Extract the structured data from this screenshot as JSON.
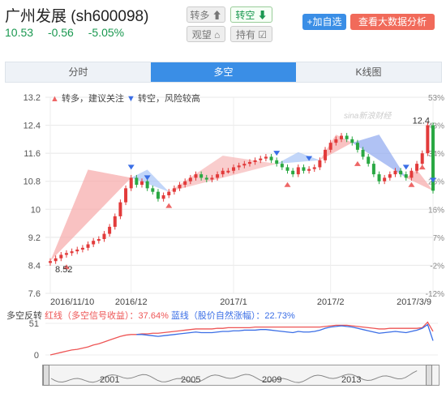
{
  "stock": {
    "name_code": "广州发展 (sh600098)",
    "price": "10.53",
    "change": "-0.56",
    "change_pct": "-5.05%"
  },
  "ops": {
    "to_long": "转多 ⬆",
    "to_short": "转空 ⬇",
    "watch": "观望 ⌂",
    "hold": "持有 ☑"
  },
  "buttons": {
    "add_watch": "+加自选",
    "big_data": "查看大数据分析"
  },
  "tabs": [
    "分时",
    "多空",
    "K线图"
  ],
  "legend": {
    "up_text": "转多，建议关注",
    "down_text": "转空，风险较高"
  },
  "watermark": "sina新浪财经",
  "chart_data": {
    "type": "candlestick",
    "y_left_ticks": [
      "13.2",
      "12.4",
      "11.6",
      "10.8",
      "10",
      "9.2",
      "8.4",
      "7.6"
    ],
    "y_right_ticks": [
      "53%",
      "43%",
      "34%",
      "25%",
      "16%",
      "7%",
      "-2%",
      "-12%"
    ],
    "x_ticks": [
      "2016/11/10",
      "2016/12",
      "2017/1",
      "2017/2",
      "2017/3/9"
    ],
    "ylim": [
      7.6,
      13.2
    ],
    "low_label": "8.52",
    "high_label": "12.4",
    "close": [
      8.52,
      8.6,
      8.7,
      8.75,
      8.8,
      8.85,
      8.9,
      9.0,
      9.1,
      9.15,
      9.3,
      9.5,
      9.8,
      10.2,
      10.6,
      10.9,
      10.7,
      10.8,
      10.6,
      10.5,
      10.3,
      10.4,
      10.5,
      10.6,
      10.7,
      10.8,
      10.9,
      11.0,
      10.9,
      10.85,
      10.9,
      11.0,
      11.1,
      11.1,
      11.2,
      11.25,
      11.3,
      11.35,
      11.4,
      11.45,
      11.5,
      11.4,
      11.3,
      11.2,
      11.1,
      11.0,
      11.2,
      11.1,
      11.15,
      11.2,
      11.4,
      11.7,
      11.9,
      12.0,
      12.1,
      12.0,
      11.9,
      11.7,
      11.5,
      11.3,
      11.0,
      10.8,
      10.9,
      11.0,
      11.1,
      11.0,
      10.9,
      11.1,
      11.3,
      11.6,
      12.4,
      10.53
    ],
    "sub_label": "多空反转",
    "sub_red_label": "红线（多空信号收益）：37.64%",
    "sub_blue_label": "蓝线（股价自然涨幅）：22.73%",
    "sub_y_ticks": [
      "51",
      "0"
    ],
    "red_line": [
      0,
      2,
      4,
      6,
      8,
      9,
      11,
      13,
      16,
      18,
      21,
      24,
      27,
      30,
      32,
      33,
      33,
      34,
      34,
      35,
      35,
      36,
      37,
      38,
      39,
      40,
      41,
      42,
      42,
      42,
      42,
      43,
      43,
      44,
      44,
      44,
      44,
      44,
      45,
      45,
      45,
      45,
      45,
      45,
      45,
      45,
      45,
      45,
      45,
      45,
      45,
      46,
      47,
      48,
      48,
      48,
      47,
      46,
      45,
      44,
      43,
      42,
      42,
      43,
      43,
      43,
      43,
      43,
      43,
      44,
      53,
      38
    ],
    "blue_line": [
      null,
      null,
      null,
      null,
      null,
      null,
      null,
      null,
      null,
      null,
      null,
      null,
      null,
      null,
      null,
      null,
      33,
      33,
      32,
      31,
      30,
      31,
      32,
      33,
      34,
      35,
      36,
      37,
      36,
      36,
      36,
      37,
      38,
      38,
      39,
      39,
      40,
      40,
      40,
      41,
      41,
      40,
      39,
      38,
      37,
      36,
      38,
      37,
      37,
      38,
      40,
      43,
      45,
      46,
      47,
      46,
      45,
      43,
      41,
      39,
      37,
      35,
      36,
      37,
      38,
      37,
      36,
      38,
      40,
      43,
      49,
      23
    ],
    "nav_years": [
      "2001",
      "2005",
      "2009",
      "2013"
    ]
  }
}
